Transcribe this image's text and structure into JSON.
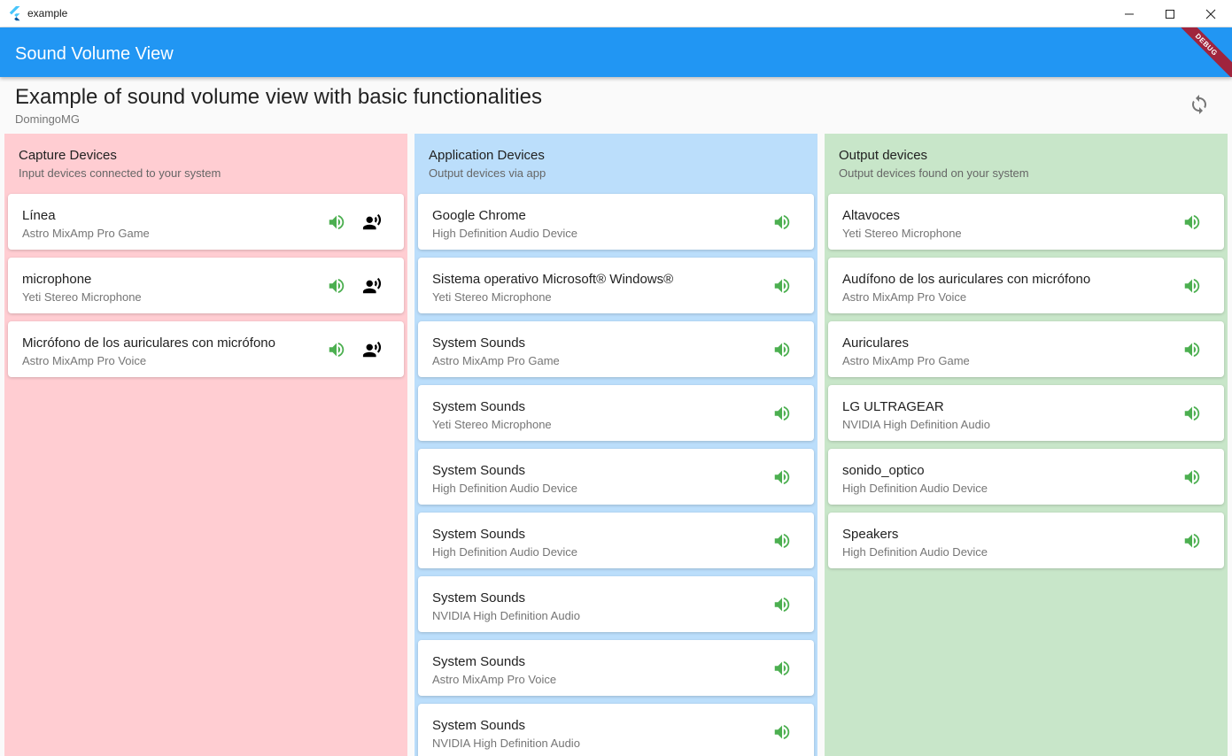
{
  "window": {
    "title": "example",
    "controls": [
      "minimize",
      "maximize",
      "close"
    ]
  },
  "appbar": {
    "title": "Sound Volume View",
    "debug_banner": "DEBUG",
    "color": "#2196f3"
  },
  "header": {
    "title": "Example of sound volume view with basic functionalities",
    "subtitle": "DomingoMG",
    "refresh_icon": "refresh-icon"
  },
  "columns": {
    "capture": {
      "title": "Capture Devices",
      "subtitle": "Input devices connected to your system",
      "color": "#ffcdd2",
      "items": [
        {
          "name": "Línea",
          "device": "Astro MixAmp Pro Game"
        },
        {
          "name": "microphone",
          "device": "Yeti Stereo Microphone"
        },
        {
          "name": "Micrófono de los auriculares con micrófono",
          "device": "Astro MixAmp Pro Voice"
        }
      ]
    },
    "application": {
      "title": "Application Devices",
      "subtitle": "Output devices via app",
      "color": "#bbdefb",
      "items": [
        {
          "name": "Google Chrome",
          "device": "High Definition Audio Device"
        },
        {
          "name": "Sistema operativo Microsoft® Windows®",
          "device": "Yeti Stereo Microphone"
        },
        {
          "name": "System Sounds",
          "device": "Astro MixAmp Pro Game"
        },
        {
          "name": "System Sounds",
          "device": "Yeti Stereo Microphone"
        },
        {
          "name": "System Sounds",
          "device": "High Definition Audio Device"
        },
        {
          "name": "System Sounds",
          "device": "High Definition Audio Device"
        },
        {
          "name": "System Sounds",
          "device": "NVIDIA High Definition Audio"
        },
        {
          "name": "System Sounds",
          "device": "Astro MixAmp Pro Voice"
        },
        {
          "name": "System Sounds",
          "device": "NVIDIA High Definition Audio"
        }
      ]
    },
    "output": {
      "title": "Output devices",
      "subtitle": "Output devices found on your system",
      "color": "#c8e6c9",
      "items": [
        {
          "name": "Altavoces",
          "device": "Yeti Stereo Microphone"
        },
        {
          "name": "Audífono de los auriculares con micrófono",
          "device": "Astro MixAmp Pro Voice"
        },
        {
          "name": "Auriculares",
          "device": "Astro MixAmp Pro Game"
        },
        {
          "name": "LG ULTRAGEAR",
          "device": "NVIDIA High Definition Audio"
        },
        {
          "name": "sonido_optico",
          "device": "High Definition Audio Device"
        },
        {
          "name": "Speakers",
          "device": "High Definition Audio Device"
        }
      ]
    }
  },
  "icons": {
    "volume": "volume-up-icon",
    "voice": "record-voice-icon",
    "volume_color": "#4caf50"
  }
}
